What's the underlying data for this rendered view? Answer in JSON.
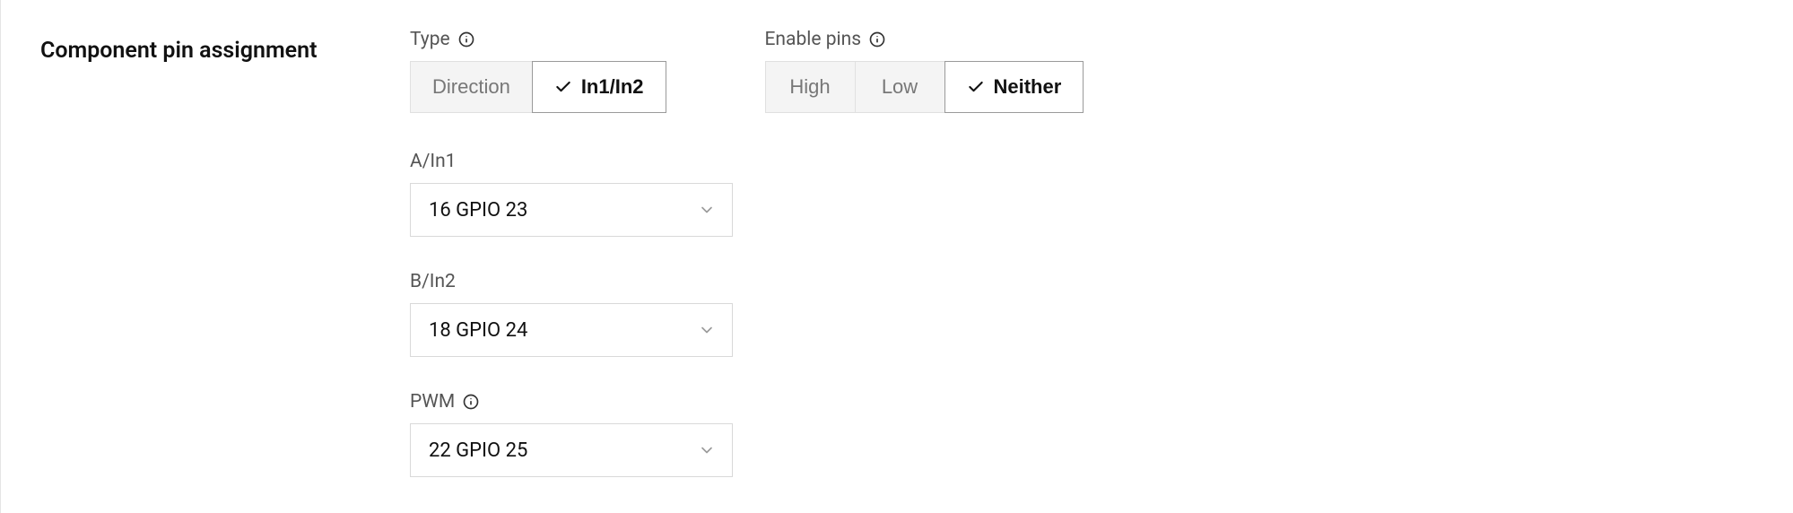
{
  "section": {
    "title": "Component pin assignment"
  },
  "type_group": {
    "label": "Type",
    "options": [
      {
        "label": "Direction",
        "selected": false
      },
      {
        "label": "In1/In2",
        "selected": true
      }
    ]
  },
  "enable_group": {
    "label": "Enable pins",
    "options": [
      {
        "label": "High",
        "selected": false
      },
      {
        "label": "Low",
        "selected": false
      },
      {
        "label": "Neither",
        "selected": true
      }
    ]
  },
  "selects": {
    "a_in1": {
      "label": "A/In1",
      "value": "16 GPIO 23"
    },
    "b_in2": {
      "label": "B/In2",
      "value": "18 GPIO 24"
    },
    "pwm": {
      "label": "PWM",
      "value": "22 GPIO 25"
    }
  }
}
